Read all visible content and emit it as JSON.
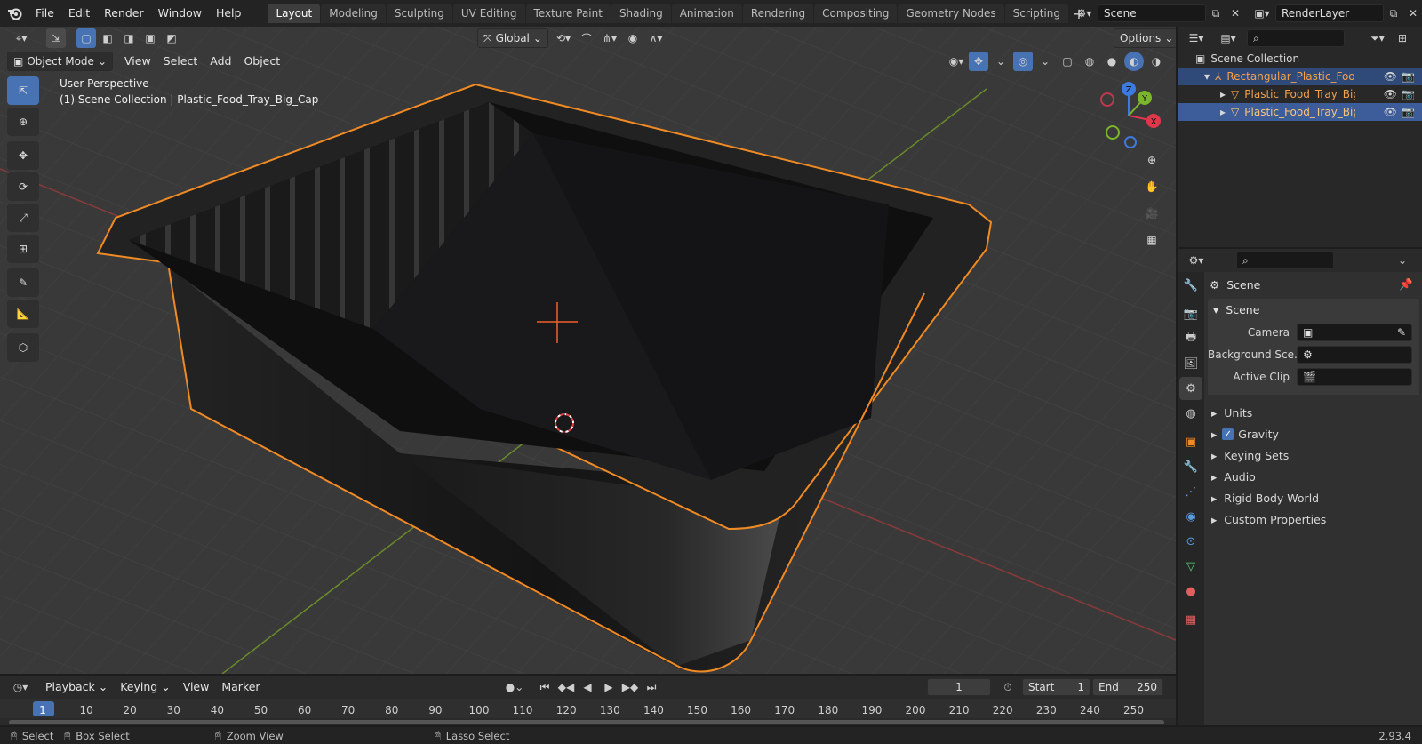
{
  "menus": [
    "File",
    "Edit",
    "Render",
    "Window",
    "Help"
  ],
  "workspace_tabs": [
    "Layout",
    "Modeling",
    "Sculpting",
    "UV Editing",
    "Texture Paint",
    "Shading",
    "Animation",
    "Rendering",
    "Compositing",
    "Geometry Nodes",
    "Scripting"
  ],
  "active_tab": "Layout",
  "scene_field": "Scene",
  "render_layer_field": "RenderLayer",
  "viewport": {
    "mode": "Object Mode",
    "menus": [
      "View",
      "Select",
      "Add",
      "Object"
    ],
    "orientation": "Global",
    "options_label": "Options",
    "perspective_label": "User Perspective",
    "collection_label": "(1) Scene Collection | Plastic_Food_Tray_Big_Cap"
  },
  "gizmo": {
    "z": "Z",
    "y": "Y",
    "x": "X"
  },
  "outliner": {
    "root": "Scene Collection",
    "items": [
      {
        "label": "Rectangular_Plastic_Food_Tr",
        "type": "empty"
      },
      {
        "label": "Plastic_Food_Tray_Big",
        "type": "mesh"
      },
      {
        "label": "Plastic_Food_Tray_Big_C",
        "type": "mesh"
      }
    ]
  },
  "properties": {
    "context_title": "Scene",
    "panel_title": "Scene",
    "fields": [
      {
        "label": "Camera"
      },
      {
        "label": "Background Sce..."
      },
      {
        "label": "Active Clip"
      }
    ],
    "subpanels": [
      "Units",
      "Gravity",
      "Keying Sets",
      "Audio",
      "Rigid Body World",
      "Custom Properties"
    ],
    "gravity_checked": true
  },
  "timeline": {
    "menus": [
      "Playback",
      "Keying",
      "View",
      "Marker"
    ],
    "current_frame": "1",
    "start_label": "Start",
    "start_value": "1",
    "end_label": "End",
    "end_value": "250",
    "ruler": [
      "1",
      "10",
      "20",
      "30",
      "40",
      "50",
      "60",
      "70",
      "80",
      "90",
      "100",
      "110",
      "120",
      "130",
      "140",
      "150",
      "160",
      "170",
      "180",
      "190",
      "200",
      "210",
      "220",
      "230",
      "240",
      "250"
    ]
  },
  "status": {
    "select": "Select",
    "box_select": "Box Select",
    "zoom_view": "Zoom View",
    "lasso_select": "Lasso Select",
    "version": "2.93.4"
  },
  "colors": {
    "accent": "#4772b3",
    "selection_outline": "#f08a24",
    "outliner_selected_text": "#f4a04a"
  }
}
